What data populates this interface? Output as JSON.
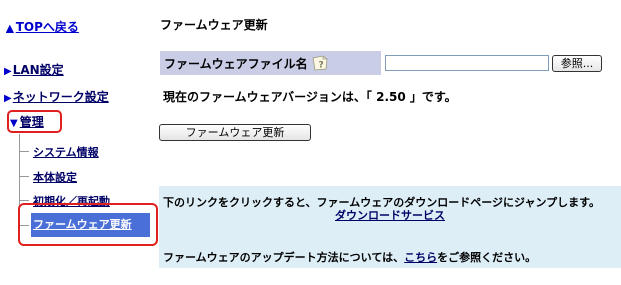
{
  "nav": {
    "top_link": "TOPへ戻る",
    "lan": "LAN設定",
    "network": "ネットワーク設定",
    "management": "管理",
    "sub_items": [
      "システム情報",
      "本体設定",
      "初期化／再起動",
      "ファームウェア更新"
    ]
  },
  "main": {
    "title": "ファームウェア更新",
    "file_label": "ファームウェアファイル名",
    "file_value": "",
    "browse_label": "参照...",
    "version_text": "現在のファームウェアバージョンは、「 2.50 」です。",
    "update_button": "ファームウェア更新",
    "info": {
      "line1": "下のリンクをクリックすると、ファームウェアのダウンロードページにジャンプします。",
      "download_link": "ダウンロードサービス",
      "line2_prefix": "ファームウェアのアップデート方法については、",
      "line2_link": "こちら",
      "line2_suffix": "をご参照ください。"
    }
  },
  "colors": {
    "highlight_box": "#e0201e",
    "active_item_bg": "#4a6fd6",
    "label_cell_bg": "#c9cde6",
    "info_bg": "#ddeef6"
  }
}
